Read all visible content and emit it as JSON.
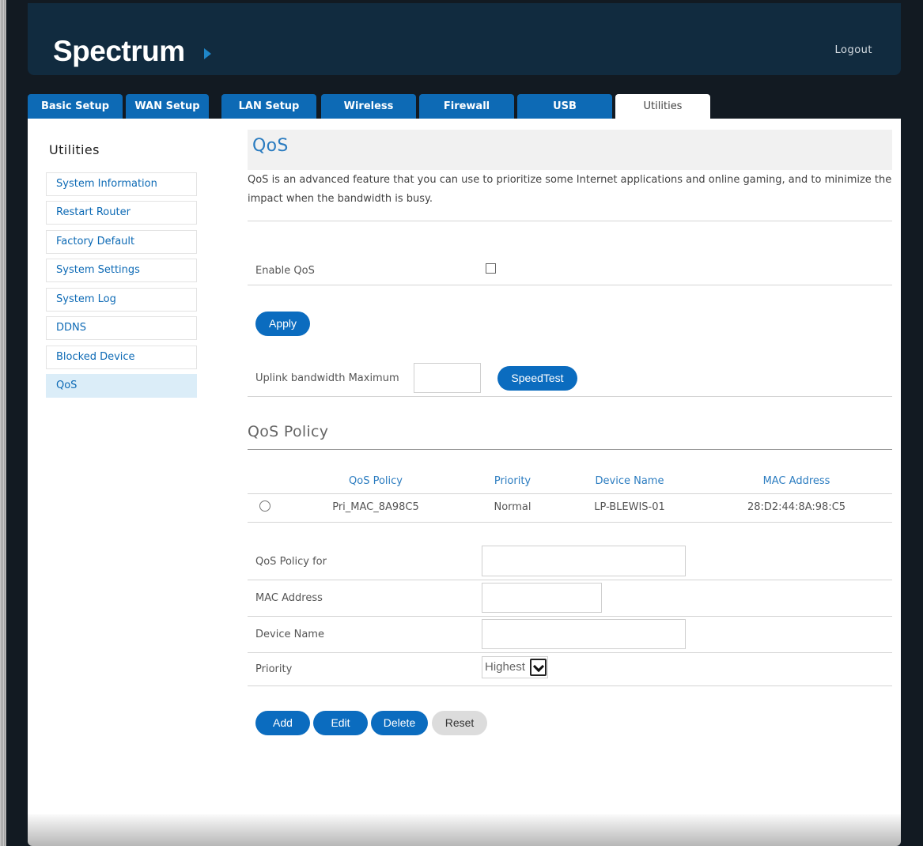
{
  "header": {
    "brand": "Spectrum",
    "logout_label": "Logout"
  },
  "tabs": [
    "Basic Setup",
    "WAN Setup",
    "LAN Setup",
    "Wireless",
    "Firewall",
    "USB",
    "Utilities"
  ],
  "active_tab": "Utilities",
  "sidebar": {
    "title": "Utilities",
    "items": [
      "System Information",
      "Restart Router",
      "Factory Default",
      "System Settings",
      "System Log",
      "DDNS",
      "Blocked Device",
      "QoS"
    ],
    "active_item": "QoS"
  },
  "main": {
    "title": "QoS",
    "description": "QoS is an advanced feature that you can use to prioritize some Internet applications and online gaming, and to minimize the impact when the bandwidth is busy.",
    "enable_qos_label": "Enable QoS",
    "enable_qos_checked": false,
    "apply_label": "Apply",
    "uplink_label": "Uplink bandwidth Maximum",
    "uplink_value": "",
    "speedtest_label": "SpeedTest",
    "policy_section_title": "QoS Policy",
    "table": {
      "headers": [
        "QoS Policy",
        "Priority",
        "Device Name",
        "MAC Address"
      ],
      "rows": [
        {
          "policy": "Pri_MAC_8A98C5",
          "priority": "Normal",
          "device": "LP-BLEWIS-01",
          "mac": "28:D2:44:8A:98:C5"
        }
      ]
    },
    "form": {
      "policy_for_label": "QoS Policy for",
      "policy_for_value": "",
      "mac_label": "MAC Address",
      "mac_value": "",
      "device_label": "Device Name",
      "device_value": "",
      "priority_label": "Priority",
      "priority_selected": "Highest"
    },
    "buttons": {
      "add": "Add",
      "edit": "Edit",
      "delete": "Delete",
      "reset": "Reset"
    }
  },
  "colors": {
    "brand_blue": "#0b6cbf",
    "header_bg": "#112b3f",
    "active_side": "#dbedf8"
  }
}
